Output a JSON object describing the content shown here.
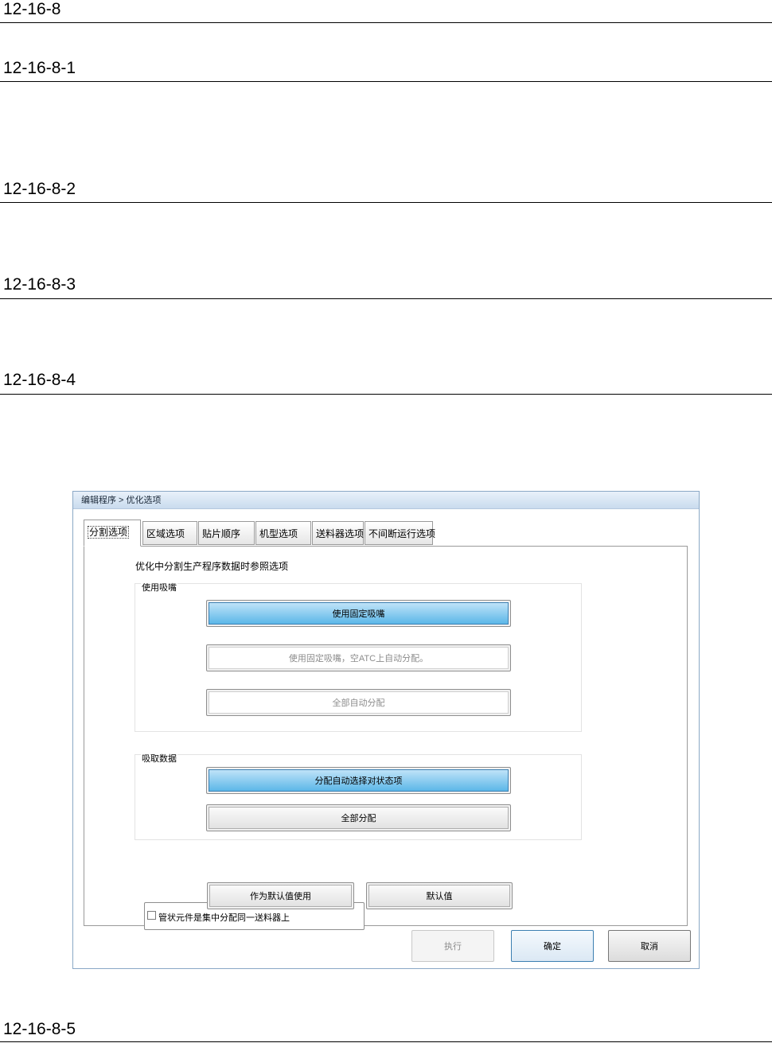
{
  "headings": [
    "12-16-8",
    "12-16-8-1",
    "12-16-8-2",
    "12-16-8-3",
    "12-16-8-4",
    "12-16-8-5"
  ],
  "dialog": {
    "title": "编辑程序 > 优化选项",
    "tabs": [
      "分割选项",
      "区域选项",
      "贴片顺序",
      "机型选项",
      "送料器选项",
      "不间断运行选项"
    ],
    "active_tab": "分割选项",
    "caption": "优化中分割生产程序数据时参照选项",
    "nozzle_group": {
      "title": "使用吸嘴",
      "buttons": [
        "使用固定吸嘴",
        "使用固定吸嘴，空ATC上自动分配。",
        "全部自动分配"
      ]
    },
    "pickup_group": {
      "title": "吸取数据",
      "buttons": [
        "分配自动选择对状态项",
        "全部分配"
      ]
    },
    "checkbox_label": "管状元件是集中分配同一送料器上",
    "set_default_label": "作为默认值使用",
    "default_label": "默认值",
    "footer": {
      "execute": "执行",
      "ok": "确定",
      "cancel": "取消"
    }
  }
}
